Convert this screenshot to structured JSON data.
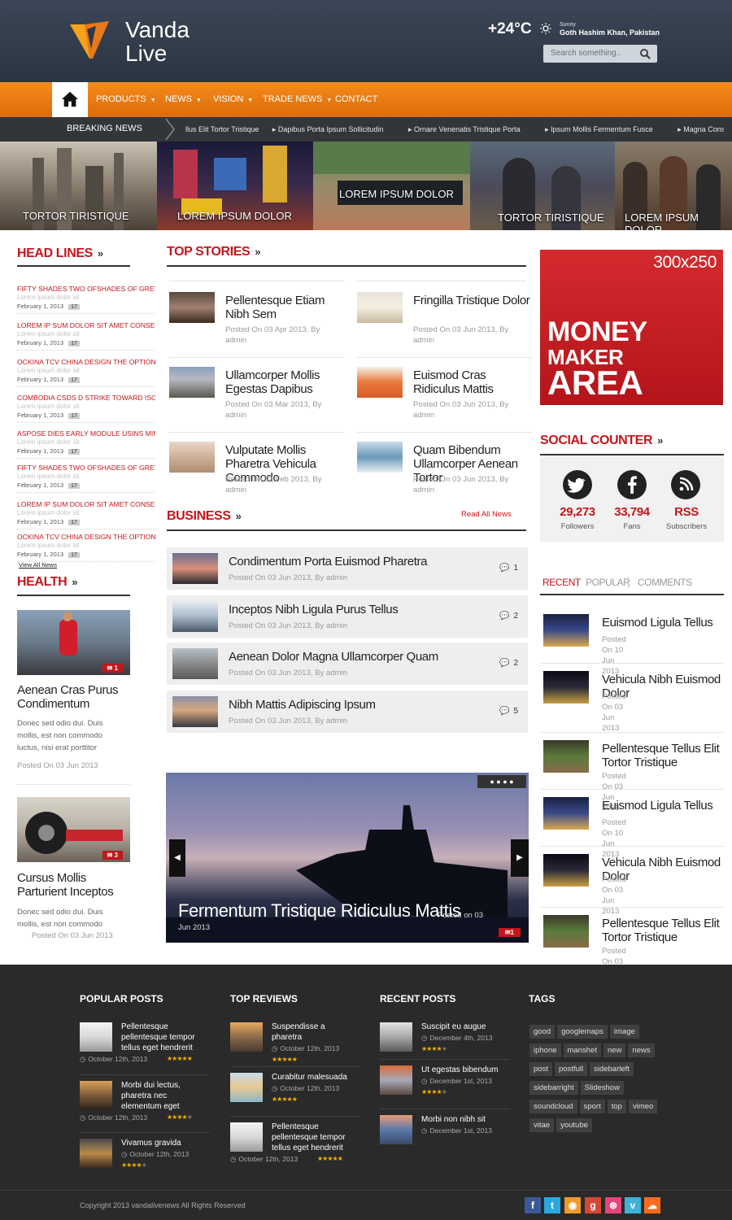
{
  "brand": {
    "name": "Vanda Live"
  },
  "weather": {
    "temp": "+24°C",
    "condition": "Sunny",
    "location": "Goth Hashim Khan, Pakistan"
  },
  "search": {
    "placeholder": "Search something.."
  },
  "nav": {
    "items": [
      "PRODUCTS",
      "NEWS",
      "VISION",
      "TRADE NEWS",
      "CONTACT"
    ]
  },
  "breaking": {
    "label": "BREAKING NEWS",
    "items": [
      "llus Elit Tortor Tristique",
      "Dapibus Porta Ipsum Sollicitudin",
      "Ornare Venenatis Tristique Porta",
      "Ipsum Mollis Fermentum Fusce",
      "Magna Consectetur"
    ]
  },
  "strip": {
    "captions": [
      "TORTOR TIRISTIQUE",
      "LOREM IPSUM DOLOR",
      "LOREM IPSUM DOLOR",
      "TORTOR TIRISTIQUE",
      "LOREM IPSUM DOLOR"
    ]
  },
  "headlines": {
    "title": "HEAD LINES",
    "items": [
      {
        "title": "FIFTY SHADES TWO OFSHADES OF GREY\"",
        "sub": "Lorem ipsum dolor sit",
        "date": "February 1, 2013",
        "count": "17"
      },
      {
        "title": "LOREM IP SUM DOLOR SIT AMET CONSEC",
        "sub": "Lorem ipsum dolor sit",
        "date": "February 1, 2013",
        "count": "17"
      },
      {
        "title": "OCKINA TCV CHINA DESIGN THE OPTION",
        "sub": "Lorem ipsum dolor sit",
        "date": "February 1, 2013",
        "count": "17"
      },
      {
        "title": "COMBODIA CSDS D STRIKE TOWARD ISO",
        "sub": "Lorem ipsum dolor sit",
        "date": "February 1, 2013",
        "count": "17"
      },
      {
        "title": "ASPOSE DIES EARLY MODULE USINS MIN",
        "sub": "Lorem ipsum dolor sit",
        "date": "February 1, 2013",
        "count": "17"
      },
      {
        "title": "FIFTY SHADES TWO OFSHADES OF GREY\"",
        "sub": "Lorem ipsum dolor sit",
        "date": "February 1, 2013",
        "count": "17"
      },
      {
        "title": "LOREM IP SUM DOLOR SIT AMET CONSEC",
        "sub": "Lorem ipsum dolor sit",
        "date": "February 1, 2013",
        "count": "17"
      },
      {
        "title": "OCKINA TCV CHINA DESIGN THE OPTION",
        "sub": "Lorem ipsum dolor sit",
        "date": "February 1, 2013",
        "count": "17"
      }
    ],
    "view_all": "View All News"
  },
  "health": {
    "title": "HEALTH",
    "items": [
      {
        "title": "Aenean Cras Purus Condimentum",
        "body": "Donec sed odio dui. Duis mollis, est non commodo luctus, nisi erat porttitor",
        "date": "Posted On 03 Jun 2013",
        "comments": "1"
      },
      {
        "title": "Cursus Mollis Parturient Inceptos",
        "body": "Donec sed odio dui. Duis mollis, est non commodo",
        "date": "Posted On 03 Jun 2013",
        "comments": "3"
      }
    ]
  },
  "top_stories": {
    "title": "TOP STORIES",
    "left": [
      {
        "title": "Pellentesque Etiam Nibh Sem",
        "meta": "Posted On 03 Apr 2013, By admin"
      },
      {
        "title": "Ullamcorper Mollis Egestas Dapibus",
        "meta": "Posted On 03 Mar 2013, By admin"
      },
      {
        "title": "Vulputate Mollis Pharetra Vehicula Commodo",
        "meta": "Posted On 03 Feb 2013, By admin"
      }
    ],
    "right": [
      {
        "title": "Fringilla Tristique Dolor",
        "meta": "Posted On 03 Jun 2013, By admin"
      },
      {
        "title": "Euismod Cras Ridiculus Mattis",
        "meta": "Posted On 03 Jun 2013, By admin"
      },
      {
        "title": "Quam Bibendum Ullamcorper Aenean Tortor",
        "meta": "Posted On 03 Jun 2013, By admin"
      }
    ]
  },
  "business": {
    "title": "BUSINESS",
    "read_all": "Read All News",
    "items": [
      {
        "title": "Condimentum Porta Euismod Pharetra",
        "meta": "Posted On 03 Jun 2013, By admin",
        "comments": "1"
      },
      {
        "title": "Inceptos Nibh Ligula Purus Tellus",
        "meta": "Posted On 03 Jun 2013, By admin",
        "comments": "2"
      },
      {
        "title": "Aenean Dolor Magna Ullamcorper Quam",
        "meta": "Posted On 03 Jun 2013, By admin",
        "comments": "2"
      },
      {
        "title": "Nibh Mattis Adipiscing Ipsum",
        "meta": "Posted On 03 Jun 2013, By admin",
        "comments": "5"
      }
    ]
  },
  "slider": {
    "title": "Fermentum Tristique Ridiculus Mattis",
    "posted_a": "Posted on 03",
    "posted_b": "Jun 2013",
    "comments": "1"
  },
  "ad": {
    "size": "300x250",
    "line1": "MONEY",
    "line2": "MAKER",
    "line3": "AREA"
  },
  "social": {
    "title": "SOCIAL COUNTER",
    "items": [
      {
        "count": "29,273",
        "label": "Followers",
        "icon": "twitter-icon"
      },
      {
        "count": "33,794",
        "label": "Fans",
        "icon": "facebook-icon"
      },
      {
        "count": "RSS",
        "label": "Subscribers",
        "icon": "rss-icon"
      }
    ]
  },
  "tabs": {
    "labels": [
      "RECENT",
      "POPULAR",
      "COMMENTS"
    ]
  },
  "recent": {
    "items": [
      {
        "title": "Euismod Ligula Tellus",
        "date": "Posted On 10 Jun 2013"
      },
      {
        "title": "Vehicula Nibh Euismod Dolor",
        "date": "Posted On 03 Jun 2013"
      },
      {
        "title": "Pellentesque Tellus Elit Tortor Tristique",
        "date": "Posted On 03 Jun 2013"
      },
      {
        "title": "Euismod Ligula Tellus",
        "date": "Posted On 10 Jun 2013"
      },
      {
        "title": "Vehicula Nibh Euismod Dolor",
        "date": "Posted On 03 Jun 2013"
      },
      {
        "title": "Pellentesque Tellus Elit Tortor Tristique",
        "date": "Posted On 03 Jun 2013"
      }
    ]
  },
  "footer": {
    "popular": {
      "title": "POPULAR POSTS",
      "items": [
        {
          "title": "Pellentesque pellentesque tempor tellus eget hendrerit",
          "date": "October 12th, 2013",
          "rating": 5
        },
        {
          "title": "Morbi dui lectus, pharetra nec elementum eget",
          "date": "October 12th, 2013",
          "rating": 4
        },
        {
          "title": "Vivamus gravida",
          "date": "October 12th, 2013",
          "rating": 4
        }
      ]
    },
    "reviews": {
      "title": "TOP REVIEWS",
      "items": [
        {
          "title": "Suspendisse a pharetra",
          "date": "October 12th, 2013",
          "rating": 5
        },
        {
          "title": "Curabitur malesuada",
          "date": "October 12th, 2013",
          "rating": 5
        },
        {
          "title": "Pellentesque pellentesque tempor tellus eget hendrerit",
          "date": "October 12th, 2013",
          "rating": 5
        }
      ]
    },
    "recent": {
      "title": "RECENT POSTS",
      "items": [
        {
          "title": "Suscipit eu augue",
          "date": "December 4th, 2013",
          "rating": 4
        },
        {
          "title": "Ut egestas bibendum",
          "date": "December 1st, 2013",
          "rating": 4
        },
        {
          "title": "Morbi non nibh sit",
          "date": "December 1st, 2013",
          "rating": 0
        }
      ]
    },
    "tags": {
      "title": "TAGS",
      "items": [
        "good",
        "googlemaps",
        "image",
        "iphone",
        "manshet",
        "new",
        "news",
        "post",
        "postfull",
        "sidebarleft",
        "sidebarright",
        "Slideshow",
        "soundcloud",
        "sport",
        "top",
        "vimeo",
        "vitae",
        "youtube"
      ]
    },
    "copyright": "Copyright 2013 vandalivenews All Rights Reserved"
  }
}
